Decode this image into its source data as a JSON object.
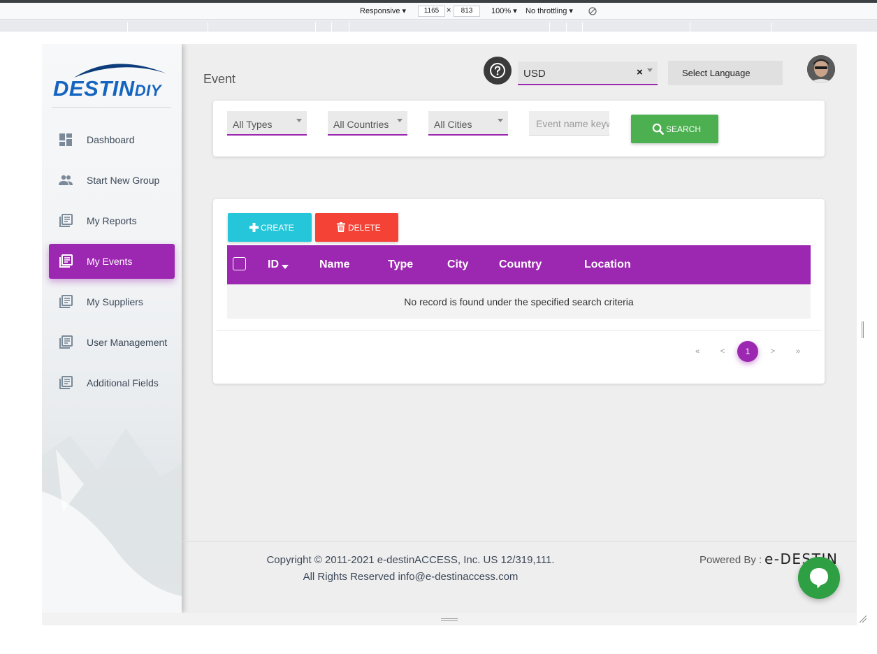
{
  "devtools": {
    "device": "Responsive",
    "width": "1165",
    "height": "813",
    "times": "×",
    "zoom": "100%",
    "throttling": "No throttling"
  },
  "app": {
    "logo_text": "DESTIN",
    "logo_suffix": "DIY",
    "page_title": "Event"
  },
  "sidebar": {
    "items": [
      {
        "label": "Dashboard",
        "icon": "dashboard-icon"
      },
      {
        "label": "Start New Group",
        "icon": "group-icon"
      },
      {
        "label": "My Reports",
        "icon": "library-books-icon"
      },
      {
        "label": "My Events",
        "icon": "library-books-icon",
        "active": true
      },
      {
        "label": "My Suppliers",
        "icon": "library-books-icon"
      },
      {
        "label": "User Management",
        "icon": "library-books-icon"
      },
      {
        "label": "Additional Fields",
        "icon": "library-books-icon"
      }
    ]
  },
  "header": {
    "currency": "USD",
    "currency_clear": "×",
    "language": "Select Language"
  },
  "filters": {
    "types": "All Types",
    "countries": "All Countries",
    "cities": "All Cities",
    "keyword_placeholder": "Event name keyword",
    "search_label": "SEARCH"
  },
  "table": {
    "create_label": "CREATE",
    "delete_label": "DELETE",
    "columns": [
      "ID",
      "Name",
      "Type",
      "City",
      "Country",
      "Location"
    ],
    "empty_message": "No record is found under the specified search criteria"
  },
  "pagination": {
    "first": "«",
    "prev": "<",
    "current": "1",
    "next": ">",
    "last": "»"
  },
  "footer": {
    "copyright": "Copyright © 2011-2021 e-destinACCESS, Inc. US 12/319,111.",
    "rights": "All Rights Reserved info@e-destinaccess.com",
    "powered_by": "Powered By :",
    "powered_logo": "e-DESTIN"
  },
  "colors": {
    "primary": "#9c27b0",
    "create": "#26c6da",
    "delete": "#f44336",
    "search": "#4caf50",
    "chat": "#2ea043"
  }
}
